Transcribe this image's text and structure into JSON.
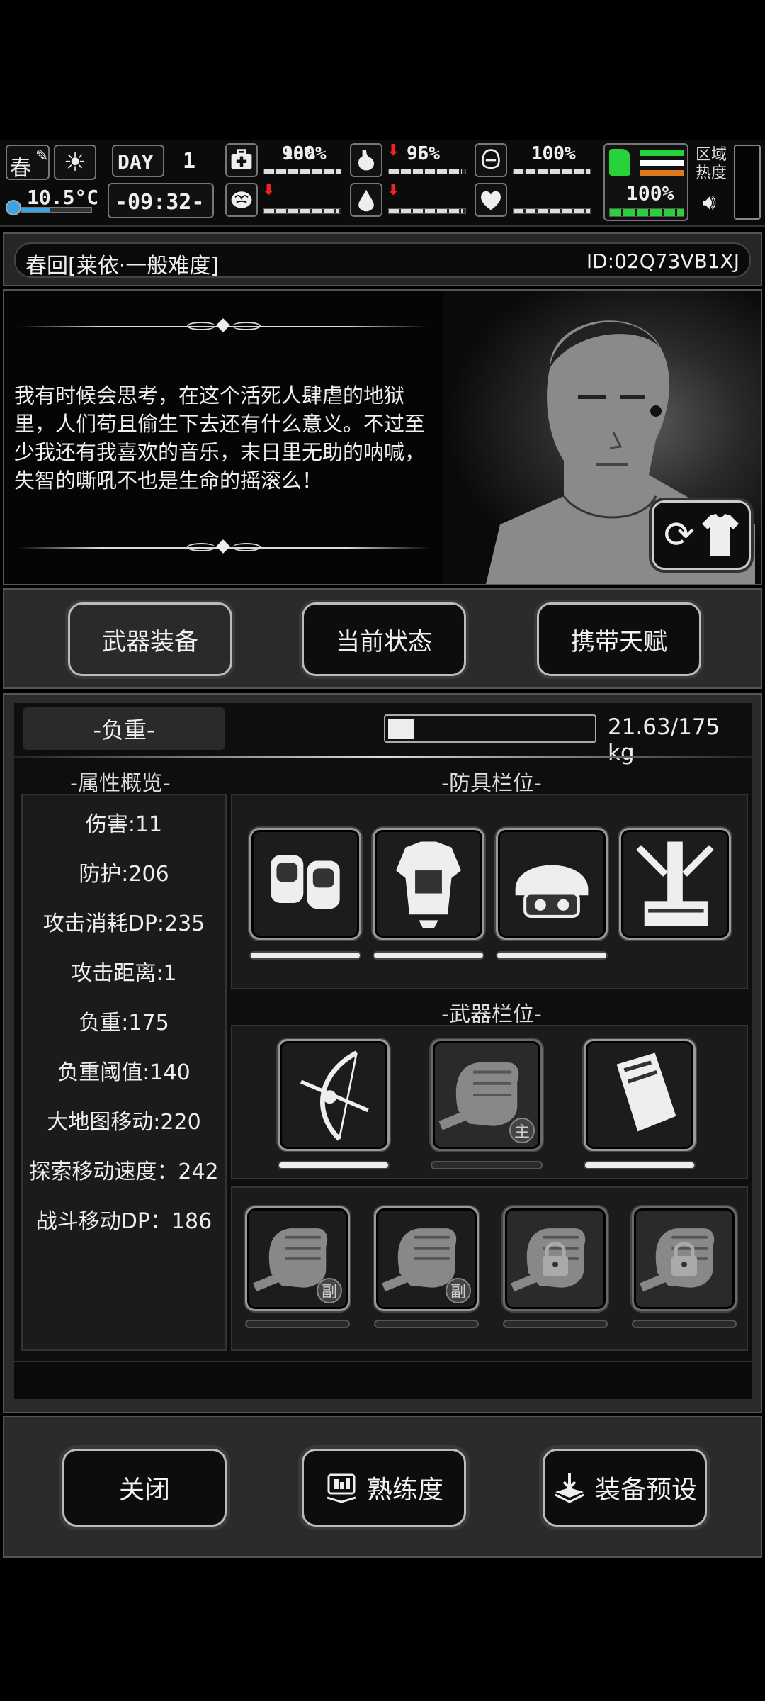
{
  "hud": {
    "season": "春",
    "temperature": "10.5°C",
    "day_label": "DAY",
    "day_number": "1",
    "time": "-09:32-",
    "stats": [
      {
        "icon": "medkit-icon",
        "value": "100%",
        "arrow": false,
        "fill": 1.0
      },
      {
        "icon": "stomach-icon",
        "value": "95%",
        "arrow": true,
        "fill": 0.95
      },
      {
        "icon": "bladder-icon",
        "value": "100%",
        "arrow": false,
        "fill": 1.0
      },
      {
        "icon": "brain-icon",
        "value": "98%",
        "arrow": true,
        "fill": 0.98
      },
      {
        "icon": "water-drop-icon",
        "value": "96%",
        "arrow": true,
        "fill": 0.96
      },
      {
        "icon": "heart-icon",
        "value": "100%",
        "arrow": false,
        "fill": 1.0
      }
    ],
    "stamina": "100%",
    "stamina_fill": 1.0,
    "zone_heat_label": "区域\n热度",
    "colors": {
      "stamina_green": "#27d23a",
      "stripe_orange": "#e0781c",
      "stripe_white": "#ffffff"
    }
  },
  "header": {
    "title": "春回[莱依·一般难度]",
    "id": "ID:02Q73VB1XJ"
  },
  "story": {
    "text": "我有时候会思考，在这个活死人肆虐的地狱里，人们苟且偷生下去还有什么意义。不过至少我还有我喜欢的音乐，末日里无助的呐喊，失智的嘶吼不也是生命的摇滚么！"
  },
  "tabs": [
    {
      "label": "武器装备",
      "active": true
    },
    {
      "label": "当前状态",
      "active": false
    },
    {
      "label": "携带天赋",
      "active": false
    }
  ],
  "weight": {
    "label": "-负重-",
    "value": "21.63/175 kg",
    "fill": 0.124
  },
  "attributes": {
    "title": "-属性概览-",
    "items": [
      "伤害:11",
      "防护:206",
      "攻击消耗DP:235",
      "攻击距离:1",
      "负重:175",
      "负重阈值:140",
      "大地图移动:220",
      "探索移动速度：242",
      "战斗移动DP：186"
    ]
  },
  "armor": {
    "title": "-防具栏位-",
    "slots": [
      {
        "icon": "knee-pads-icon",
        "durability": 1.0,
        "has_bar": true
      },
      {
        "icon": "body-armor-icon",
        "durability": 1.0,
        "has_bar": true
      },
      {
        "icon": "helmet-icon",
        "durability": 1.0,
        "has_bar": true
      },
      {
        "icon": "backpack-frame-icon",
        "durability": 0,
        "has_bar": false
      }
    ]
  },
  "weapons": {
    "title": "-武器栏位-",
    "slots": [
      {
        "icon": "compound-bow-icon",
        "badge": "",
        "dim": false
      },
      {
        "icon": "fist-icon",
        "badge": "主",
        "dim": true
      },
      {
        "icon": "supply-box-icon",
        "badge": "",
        "dim": false
      }
    ],
    "secondary": [
      {
        "icon": "fist-icon",
        "badge": "副",
        "locked": false
      },
      {
        "icon": "fist-icon",
        "badge": "副",
        "locked": false
      },
      {
        "icon": "fist-icon",
        "badge": "",
        "locked": true
      },
      {
        "icon": "fist-icon",
        "badge": "",
        "locked": true
      }
    ]
  },
  "bottom": {
    "close": "关闭",
    "proficiency": "熟练度",
    "preset": "装备预设"
  }
}
